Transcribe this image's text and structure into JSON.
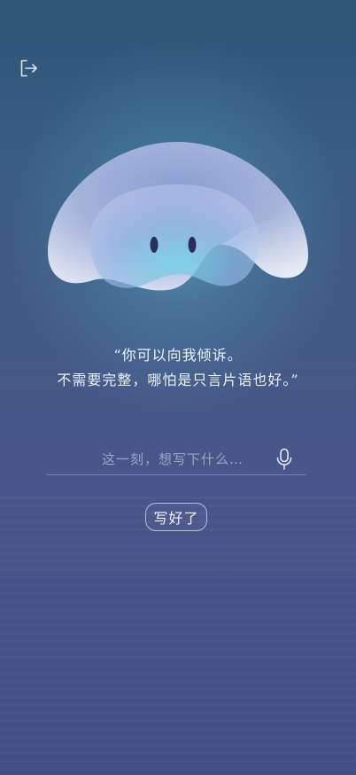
{
  "header": {
    "exit_icon": "logout-icon"
  },
  "mascot": {
    "name": "jellyfish-mascot"
  },
  "prompt": {
    "line1": "“你可以向我倾诉。",
    "line2": "不需要完整，哪怕是只言片语也好。”"
  },
  "input": {
    "placeholder": "这一刻，想写下什么…",
    "value": "",
    "mic_icon": "microphone-icon"
  },
  "actions": {
    "done_label": "写好了"
  },
  "colors": {
    "background_top": "#2c5676",
    "background_bottom": "#424f86",
    "glow": "#6ecde1",
    "text": "#eef2f8"
  }
}
